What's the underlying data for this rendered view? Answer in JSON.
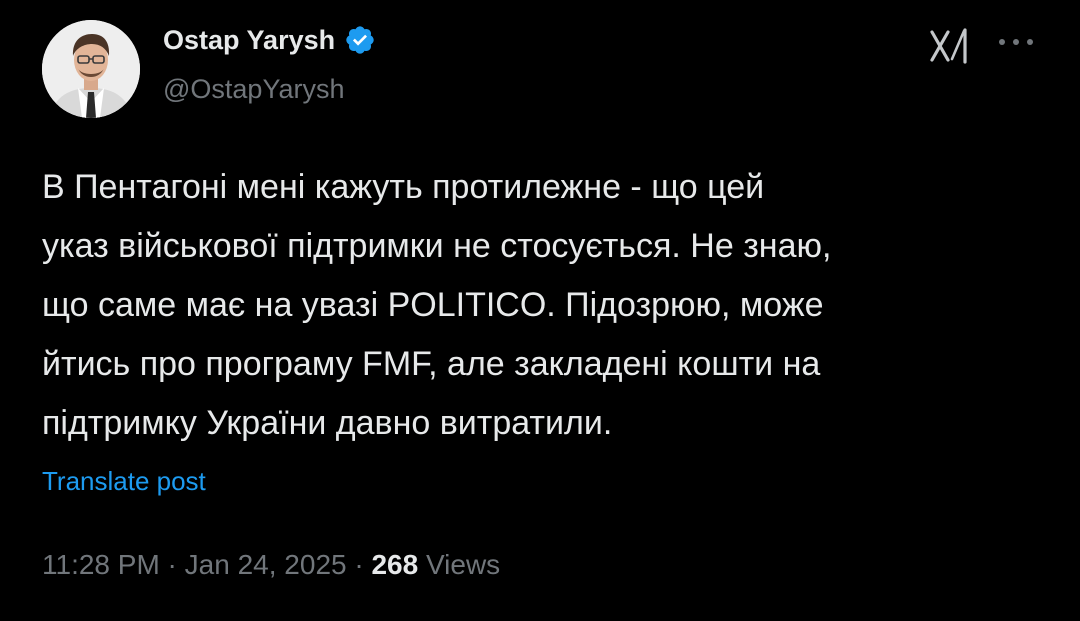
{
  "author": {
    "display_name": "Ostap Yarysh",
    "handle": "@OstapYarysh",
    "verified": true,
    "avatar": "avatar-photo"
  },
  "icons": {
    "verified": "verified-badge-icon",
    "grok": "grok-icon",
    "more": "more-options-icon"
  },
  "post": {
    "text": "В Пентагоні мені кажуть протилежне - що цей\nуказ військової підтримки не стосується. Не знаю,\nщо саме має на увазі POLITICO. Підозрюю, може\nйтись про програму FMF, але закладені кошти на\nпідтримку України давно витратили.",
    "translate_label": "Translate post"
  },
  "meta": {
    "time": "11:28 PM",
    "separator": " · ",
    "date": "Jan 24, 2025",
    "views_count": "268",
    "views_label": "Views"
  },
  "colors": {
    "background": "#000000",
    "text_primary": "#e7e9ea",
    "text_secondary": "#71767b",
    "link": "#1d9bf0",
    "verified": "#1d9bf0"
  }
}
